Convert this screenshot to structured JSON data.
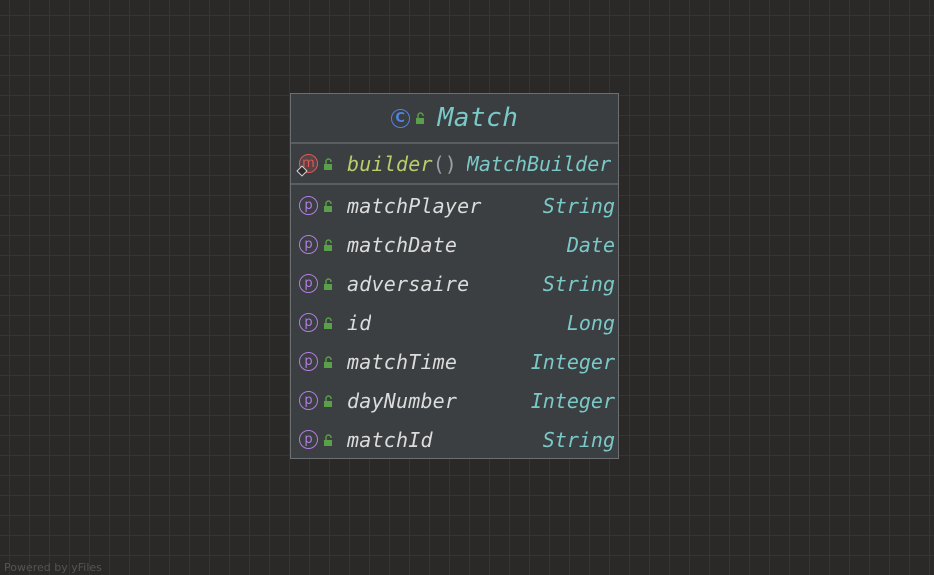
{
  "node": {
    "class_kind": "C",
    "class_name": "Match",
    "methods": [
      {
        "kind": "m",
        "name": "builder",
        "parens": "()",
        "type": "MatchBuilder"
      }
    ],
    "properties": [
      {
        "kind": "p",
        "name": "matchPlayer",
        "type": "String"
      },
      {
        "kind": "p",
        "name": "matchDate",
        "type": "Date"
      },
      {
        "kind": "p",
        "name": "adversaire",
        "type": "String"
      },
      {
        "kind": "p",
        "name": "id",
        "type": "Long"
      },
      {
        "kind": "p",
        "name": "matchTime",
        "type": "Integer"
      },
      {
        "kind": "p",
        "name": "dayNumber",
        "type": "Integer"
      },
      {
        "kind": "p",
        "name": "matchId",
        "type": "String"
      }
    ]
  },
  "credit": "Powered by yFiles",
  "colors": {
    "canvas_bg": "#2b2828",
    "node_bg": "#3b3f42",
    "class_name": "#7ac9c7",
    "type_text": "#7ac9c7",
    "method_name": "#b8cf6a",
    "property_name": "#dcdcdc",
    "class_badge": "#4f84e0",
    "method_badge": "#e05a5a",
    "property_badge": "#b27ee0",
    "lock_icon": "#5aa04a"
  },
  "icons": {
    "class": "class-icon",
    "method": "method-icon",
    "property": "property-icon",
    "visibility": "public-unlocked-icon",
    "static": "static-diamond-icon"
  }
}
